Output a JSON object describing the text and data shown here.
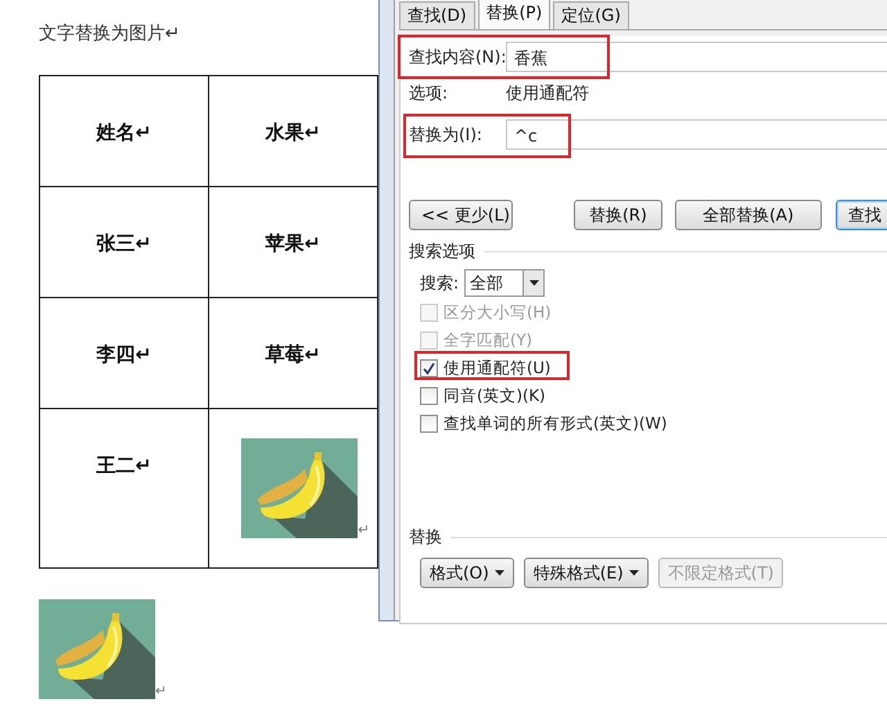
{
  "document": {
    "heading": "文字替换为图片↵",
    "table": {
      "rows": [
        [
          {
            "kind": "text",
            "text": "姓名↵"
          },
          {
            "kind": "text",
            "text": "水果↵"
          }
        ],
        [
          {
            "kind": "text",
            "text": "张三↵"
          },
          {
            "kind": "text",
            "text": "苹果↵"
          }
        ],
        [
          {
            "kind": "text",
            "text": "李四↵"
          },
          {
            "kind": "text",
            "text": "草莓↵"
          }
        ],
        [
          {
            "kind": "text",
            "text": "王二↵"
          },
          {
            "kind": "picture",
            "mark": "↵"
          }
        ]
      ]
    },
    "after_table": {
      "kind": "picture",
      "mark": "↵"
    }
  },
  "dialog": {
    "tabs": [
      {
        "label": "查找(D)",
        "selected": false
      },
      {
        "label": "替换(P)",
        "selected": true
      },
      {
        "label": "定位(G)",
        "selected": false
      }
    ],
    "find": {
      "label": "查找内容(N):",
      "value": "香蕉",
      "highlighted": true
    },
    "options": {
      "label": "选项:",
      "value": "使用通配符"
    },
    "replace": {
      "label": "替换为(I):",
      "value": "^c",
      "highlighted": true
    },
    "buttons": [
      {
        "label": "<< 更少(L)",
        "focused": false
      },
      {
        "label": "替换(R)",
        "focused": false
      },
      {
        "label": "全部替换(A)",
        "focused": false
      },
      {
        "label": "查找",
        "focused": true
      }
    ],
    "search_options": {
      "title": "搜索选项",
      "search_label": "搜索:",
      "search_value": "全部",
      "checkboxes": [
        {
          "label": "区分大小写(H)",
          "checked": false,
          "disabled": true,
          "highlighted": false
        },
        {
          "label": "全字匹配(Y)",
          "checked": false,
          "disabled": true,
          "highlighted": false
        },
        {
          "label": "使用通配符(U)",
          "checked": true,
          "disabled": false,
          "highlighted": true
        },
        {
          "label": "同音(英文)(K)",
          "checked": false,
          "disabled": false,
          "highlighted": false
        },
        {
          "label": "查找单词的所有形式(英文)(W)",
          "checked": false,
          "disabled": false,
          "highlighted": false
        }
      ]
    },
    "replace_section": {
      "title": "替换",
      "buttons": [
        {
          "label": "格式(O)",
          "dropdown": true,
          "disabled": false
        },
        {
          "label": "特殊格式(E)",
          "dropdown": true,
          "disabled": false
        },
        {
          "label": "不限定格式(T)",
          "dropdown": false,
          "disabled": true
        }
      ]
    }
  }
}
